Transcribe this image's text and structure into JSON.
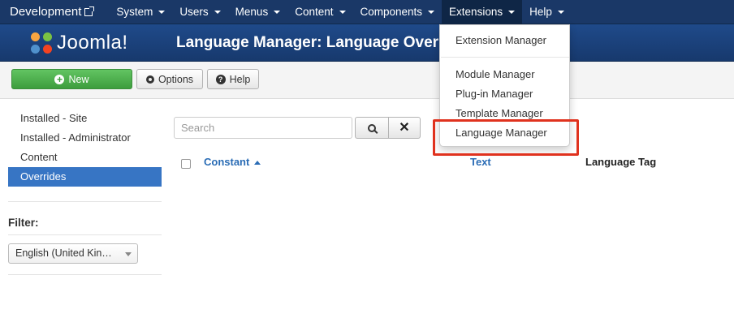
{
  "navbar": {
    "brand": "Development",
    "items": [
      {
        "label": "System"
      },
      {
        "label": "Users"
      },
      {
        "label": "Menus"
      },
      {
        "label": "Content"
      },
      {
        "label": "Components"
      },
      {
        "label": "Extensions",
        "active": true
      },
      {
        "label": "Help"
      }
    ]
  },
  "header": {
    "logo_text": "Joomla!",
    "title": "Language Manager: Language Overr"
  },
  "toolbar": {
    "new_label": "New",
    "options_label": "Options",
    "help_label": "Help"
  },
  "sidebar": {
    "items": [
      {
        "label": "Installed - Site"
      },
      {
        "label": "Installed - Administrator"
      },
      {
        "label": "Content"
      },
      {
        "label": "Overrides",
        "active": true
      }
    ],
    "filter_label": "Filter:",
    "filter_value": "English (United Kin…"
  },
  "search": {
    "placeholder": "Search"
  },
  "table": {
    "columns": [
      "Constant",
      "Text",
      "Language Tag"
    ]
  },
  "dropdown": {
    "items": [
      {
        "label": "Extension Manager"
      },
      {
        "label": "Module Manager"
      },
      {
        "label": "Plug-in Manager"
      },
      {
        "label": "Template Manager"
      },
      {
        "label": "Language Manager",
        "highlighted": true
      }
    ]
  },
  "colors": {
    "navbar": "#1a3867",
    "header": "#1f4a8a",
    "new_button": "#4cae4c",
    "sidebar_active": "#3775c4",
    "link": "#2a6cb5",
    "highlight_box": "#e0321e"
  }
}
